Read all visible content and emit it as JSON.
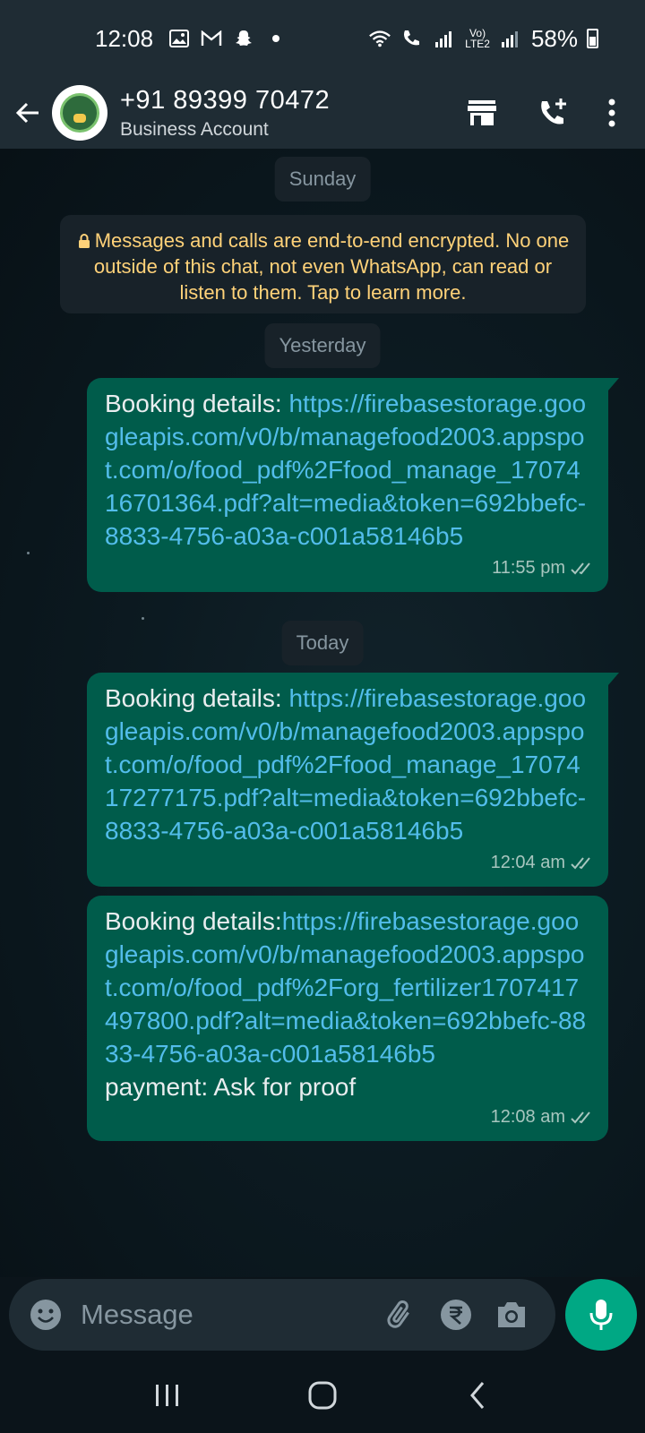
{
  "status_bar": {
    "time": "12:08",
    "battery_percent": "58%",
    "network_label_top": "Vo)",
    "network_label_bottom": "LTE2"
  },
  "header": {
    "contact_name": "+91 89399 70472",
    "subtitle": "Business Account"
  },
  "chat": {
    "date_labels": [
      "Sunday",
      "Yesterday",
      "Today"
    ],
    "encryption_notice": "Messages and calls are end-to-end encrypted. No one outside of this chat, not even WhatsApp, can read or listen to them. Tap to learn more.",
    "messages": [
      {
        "label": "Booking details: ",
        "link": "https://firebasestorage.googleapis.com/v0/b/managefood2003.appspot.com/o/food_pdf%2Ffood_manage_1707416701364.pdf?alt=media&token=692bbefc-8833-4756-a03a-c001a58146b5",
        "extra": "",
        "time": "11:55 pm"
      },
      {
        "label": "Booking details: ",
        "link": "https://firebasestorage.googleapis.com/v0/b/managefood2003.appspot.com/o/food_pdf%2Ffood_manage_1707417277175.pdf?alt=media&token=692bbefc-8833-4756-a03a-c001a58146b5",
        "extra": "",
        "time": "12:04 am"
      },
      {
        "label": "Booking details:",
        "link": "https://firebasestorage.googleapis.com/v0/b/managefood2003.appspot.com/o/food_pdf%2Forg_fertilizer1707417497800.pdf?alt=media&token=692bbefc-8833-4756-a03a-c001a58146b5",
        "extra": "payment: Ask for proof",
        "time": "12:08 am"
      }
    ]
  },
  "input": {
    "placeholder": "Message"
  },
  "colors": {
    "header_bg": "#1f2c34",
    "bubble_out": "#005c4b",
    "link": "#53bdeb",
    "accent": "#00a884",
    "notice_text": "#ffd279"
  }
}
